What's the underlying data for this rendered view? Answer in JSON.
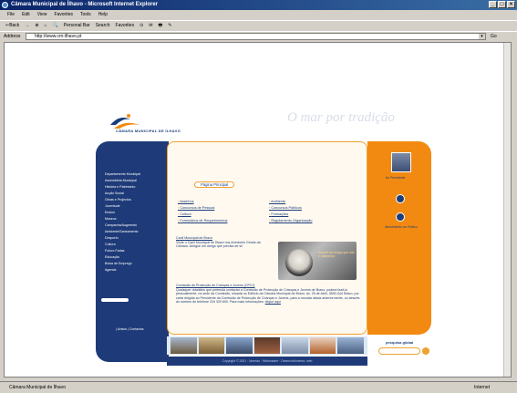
{
  "window": {
    "title": "Câmara Municipal de Ílhavo - Microsoft Internet Explorer",
    "buttons": [
      "_",
      "□",
      "×"
    ]
  },
  "menubar": [
    "File",
    "Edit",
    "View",
    "Favorites",
    "Tools",
    "Help"
  ],
  "toolbar": [
    "⇐Back",
    "→",
    "⊗",
    "⌂",
    "🔍",
    "Personal Bar",
    "Search",
    "Favorites",
    "⊙",
    "✉",
    "🖶",
    "✎"
  ],
  "address": {
    "label": "Address",
    "url": "http://www.cm-ilhavo.pt",
    "go": "Go"
  },
  "site": {
    "logo_text": "CÂMARA MUNICIPAL DE ÍLHAVO",
    "slogan": "O mar por tradição",
    "tab": "Página Principal",
    "left_nav": [
      "Departamento Municipal",
      "Assembleia Municipal",
      "História e Património",
      "Acção Social",
      "Obras e Projectos",
      "Juventude",
      "Ensino",
      "Museus",
      "Campanha/Augmento",
      "Ambiente/Saneamento",
      "Desporto",
      "Cultura",
      "Futuro Fadas",
      "Educação",
      "Bolsa de Emprego",
      "Agenda"
    ],
    "left_foot": "| Avisos | Contactos",
    "links_left": [
      "Assinhos",
      "Concursos de Pessoal",
      "Cultura",
      "Formulários de Requerimentos"
    ],
    "links_right": [
      "Ambiente",
      "Concursos Públicos",
      "Formações",
      "Regulamento Organização"
    ],
    "news1": {
      "title": "Canil Municipal de Ílhavo",
      "text": "Visite o Canil Municipal de Ílhavo nos Arredores Gerais da Câmara. Abrigue um amigo que precisa de si!"
    },
    "dog_caption": "Adopte um amigo que não o abandona",
    "news2": {
      "title": "Comissão de Protecção de Crianças e Jovens (CPCJ)",
      "text": "Quaisquer cidadãos que pretenda contactar a Comissão de Protecção de Crianças e Jovens de Ílhavo, poderá fazê-lo pessoalmente, na sede da Comissão, situada no Edifício da Câmara Municipal de Ílhavo, Av. 25 de Abril, 3830-044 Ílhavo, por carta dirigida ao Presidente da Comissão de Protecção de Crianças e Jovens, para a morada citada anteriormente, ou através do número de telefone 234 329 600. Para mais informações:",
      "link": "clique aqui"
    },
    "right_panel": {
      "photo_label": "Ao Presidente",
      "icon2_label": "Atendimento ao Público"
    },
    "search_label": "pesquisa global",
    "footer": "Copyright © 2001 · Normas · Webmaster · Desenvolvimento: web"
  },
  "status": {
    "text": "Câmara Municipal de Ílhavo",
    "zone": "Internet"
  },
  "colors": {
    "nav_blue": "#1e3a78",
    "accent_orange": "#f28a12"
  }
}
